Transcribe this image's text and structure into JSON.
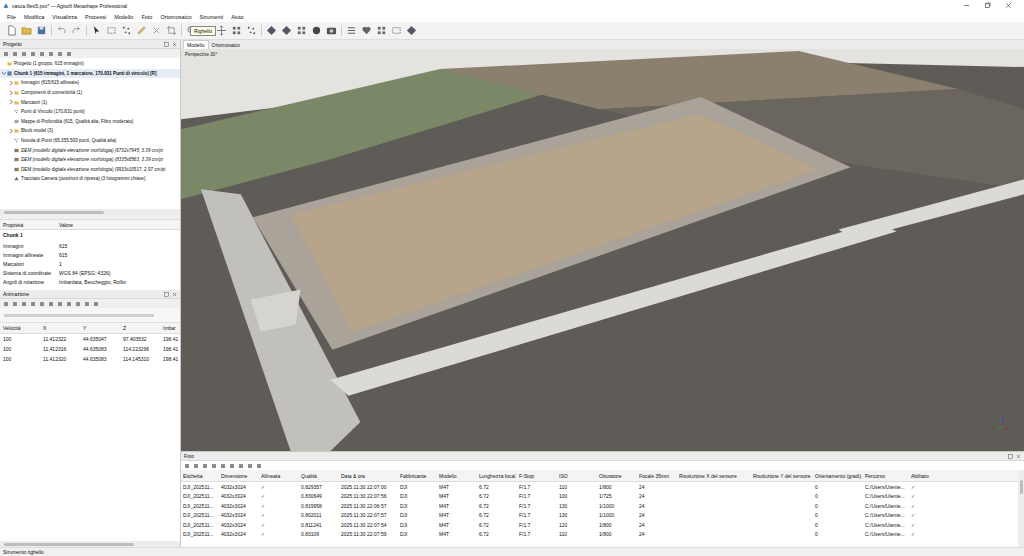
{
  "window": {
    "title": "vasca.files5.psx* — Agisoft Metashape Professional"
  },
  "menu": [
    "File",
    "Modifica",
    "Visualizza",
    "Processi",
    "Modello",
    "Foto",
    "Ortomosaico",
    "Strumenti",
    "Aiuto"
  ],
  "toolbar": {
    "tooltip": "Righello"
  },
  "project_panel": {
    "title": "Progetto",
    "tree": [
      {
        "label": "Progetto (1 gruppo, 615 immagini)",
        "kind": "project",
        "level": 0
      },
      {
        "label": "Chunk 1 (615 immagini, 1 marcatore, 170.831 Punti di vincolo) [R]",
        "kind": "chunk",
        "level": 0,
        "expanded": true
      },
      {
        "label": "Immagini (615/615 allineate)",
        "kind": "folder",
        "level": 1,
        "expanded": false
      },
      {
        "label": "Componenti di connettività (1)",
        "kind": "folder",
        "level": 1,
        "expanded": false
      },
      {
        "label": "Marcatori (1)",
        "kind": "folder",
        "level": 1,
        "expanded": false
      },
      {
        "label": "Punti di Vincolo (170.831 punti)",
        "kind": "points",
        "level": 1
      },
      {
        "label": "Mappe di Profondità (615, Qualità alta, Filtro moderato)",
        "kind": "depth",
        "level": 1
      },
      {
        "label": "Block model (3)",
        "kind": "folder",
        "level": 1,
        "expanded": false
      },
      {
        "label": "Nuvola di Punti (65.355.500 punti, Qualità alta)",
        "kind": "cloud",
        "level": 1
      },
      {
        "label": "DEM (modello digitale elevazione morfologia) (6732x7945, 3.39 cm/pi",
        "kind": "dem",
        "level": 1,
        "inactive": true
      },
      {
        "label": "DEM (modello digitale elevazione morfologia) (8335x6563, 3.39 cm/pi",
        "kind": "dem",
        "level": 1,
        "inactive": true
      },
      {
        "label": "DEM (modello digitale elevazione morfologia) (9933x10517, 2.97 cm/pi",
        "kind": "dem",
        "level": 1,
        "inactive": false
      },
      {
        "label": "Tracciato Camera (posizioni di ripresa) (3 fotogrammi chiave)",
        "kind": "track",
        "level": 1
      }
    ]
  },
  "properties": {
    "columns": [
      "Proprietà",
      "Valore"
    ],
    "section": "Chunk 1",
    "rows": [
      {
        "name": "Immagini",
        "value": "615"
      },
      {
        "name": "Immagini allineate",
        "value": "615"
      },
      {
        "name": "Marcatori",
        "value": "1"
      },
      {
        "name": "Sistema di coordinate",
        "value": "WGS 84 (EPSG::4326)"
      },
      {
        "name": "Angoli di rotazione",
        "value": "Imbardata, Beccheggio, Rollio"
      }
    ]
  },
  "animation": {
    "title": "Animazione",
    "columns": [
      "Velocità",
      "X",
      "Y",
      "Z",
      "Imbar"
    ],
    "rows": [
      [
        "100",
        "11.412322",
        "44.635047",
        "97.403532",
        "198.41"
      ],
      [
        "100",
        "11.412316",
        "44.635083",
        "114.223296",
        "198.41"
      ],
      [
        "100",
        "11.412320",
        "44.635083",
        "114.145310",
        "198.41"
      ]
    ]
  },
  "view_tabs": [
    {
      "label": "Modello",
      "selected": true
    },
    {
      "label": "Ortomosaico",
      "selected": false
    }
  ],
  "viewport": {
    "label": "Perspective 30°"
  },
  "photos": {
    "title": "Foto",
    "columns": [
      "Etichetta",
      "Dimensione",
      "Allineata",
      "Qualità",
      "Data & ora",
      "Fabbricante",
      "Modello",
      "Lunghezza focal",
      "F-Stop",
      "ISO",
      "Otturatore",
      "Focale 35mm",
      "Risoluzione X del sensore",
      "Risoluzione Y del sensore",
      "Orientamento (gradi)",
      "Percorso",
      "Abilitato"
    ],
    "rows": [
      [
        "DJI_202511...",
        "4032x3024",
        "✓",
        "0.829357",
        "2025:11:30 22:07:00",
        "DJI",
        "M4T",
        "6.72",
        "F/1.7",
        "110",
        "1/800",
        "24",
        "",
        "",
        "0",
        "C:/Users/Utente...",
        "✓"
      ],
      [
        "DJI_202511...",
        "4032x3024",
        "✓",
        "0.830649",
        "2025:11:30 22:07:56",
        "DJI",
        "M4T",
        "6.72",
        "F/1.7",
        "100",
        "1/725",
        "24",
        "",
        "",
        "0",
        "C:/Users/Utente...",
        "✓"
      ],
      [
        "DJI_202511...",
        "4032x3024",
        "✓",
        "0.819958",
        "2025:11:30 22:06:57",
        "DJI",
        "M4T",
        "6.72",
        "F/1.7",
        "130",
        "1/1000",
        "24",
        "",
        "",
        "0",
        "C:/Users/Utente...",
        "✓"
      ],
      [
        "DJI_202511...",
        "4032x3024",
        "✓",
        "0.802011",
        "2025:11:30 22:07:57",
        "DJI",
        "M4T",
        "6.72",
        "F/1.7",
        "130",
        "1/1000",
        "24",
        "",
        "",
        "0",
        "C:/Users/Utente...",
        "✓"
      ],
      [
        "DJI_202511...",
        "4032x3024",
        "✓",
        "0.811241",
        "2025:11:30 22:07:54",
        "DJI",
        "M4T",
        "6.72",
        "F/1.7",
        "120",
        "1/800",
        "24",
        "",
        "",
        "0",
        "C:/Users/Utente...",
        "✓"
      ],
      [
        "DJI_202511...",
        "4032x3024",
        "✓",
        "0.83109",
        "2025:11:30 22:07:59",
        "DJI",
        "M4T",
        "6.72",
        "F/1.7",
        "110",
        "1/800",
        "24",
        "",
        "",
        "0",
        "C:/Users/Utente...",
        "✓"
      ]
    ]
  },
  "status_bar": "Strumento righello"
}
